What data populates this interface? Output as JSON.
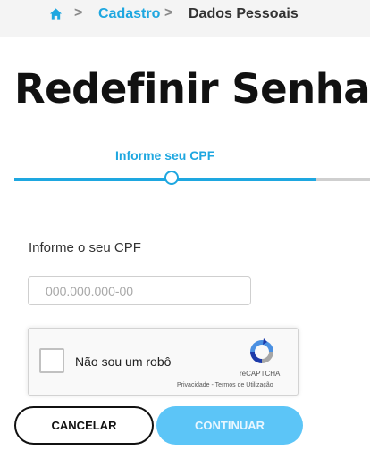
{
  "breadcrumb": {
    "home_icon": "home-icon",
    "separator": ">",
    "items": [
      {
        "label": "Cadastro"
      },
      {
        "label": "Dados Pessoais"
      }
    ]
  },
  "page": {
    "title": "Redefinir Senha"
  },
  "stepper": {
    "current_step_label": "Informe seu CPF",
    "progress": 0.85,
    "active_color": "#1ea7e0",
    "inactive_color": "#cfcfcf"
  },
  "cpf_field": {
    "label": "Informe o seu CPF",
    "placeholder": "000.000.000-00",
    "value": ""
  },
  "recaptcha": {
    "checkbox_label": "Não sou um robô",
    "brand": "reCAPTCHA",
    "terms": "Privacidade - Termos de Utilização",
    "checked": false
  },
  "actions": {
    "cancel_label": "CANCELAR",
    "continue_label": "CONTINUAR",
    "continue_color": "#5cc5f7"
  }
}
